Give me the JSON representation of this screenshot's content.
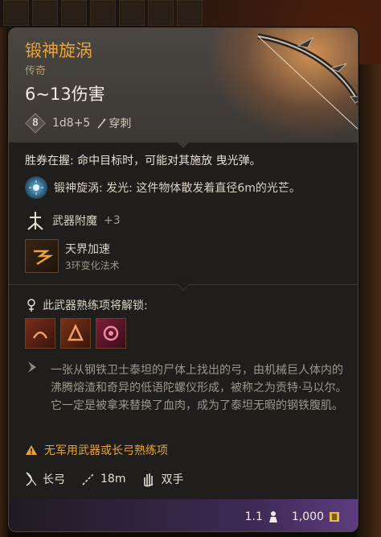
{
  "item": {
    "name": "锻神旋涡",
    "rarity": "传奇",
    "damage_title": "6~13伤害",
    "dice_number": "8",
    "damage_dice": "1d8+5",
    "damage_type": "穿刺"
  },
  "effects": {
    "passive": "胜券在握: 命中目标时，可能对其施放 曳光弹。",
    "light_name": "锻神旋涡: ",
    "light_desc": "发光: 这件物体散发着直径6m的光芒。",
    "enchant_label": "武器附魔",
    "enchant_value": "+3",
    "spell_name": "天界加速",
    "spell_level": "3环变化法术"
  },
  "proficiency": {
    "label": "此武器熟练项将解锁:",
    "icons": [
      "sweeping-strike-icon",
      "piercing-shot-icon",
      "mobile-shot-icon"
    ]
  },
  "lore": "一张从钢铁卫士泰坦的尸体上找出的弓，由机械巨人体内的沸腾熔渣和奇异的低语陀螺仪形成，被称之为贡特·马以尔。它一定是被拿来替换了血肉，成为了泰坦无暇的钢铁腹肌。",
  "warning": "无军用武器或长弓熟练项",
  "properties": {
    "weapon_type": "长弓",
    "range": "18m",
    "handedness": "双手"
  },
  "footer": {
    "weight": "1.1",
    "price": "1,000"
  },
  "colors": {
    "title": "#e8a43a",
    "rarity_accent": "#5c3c7e"
  }
}
